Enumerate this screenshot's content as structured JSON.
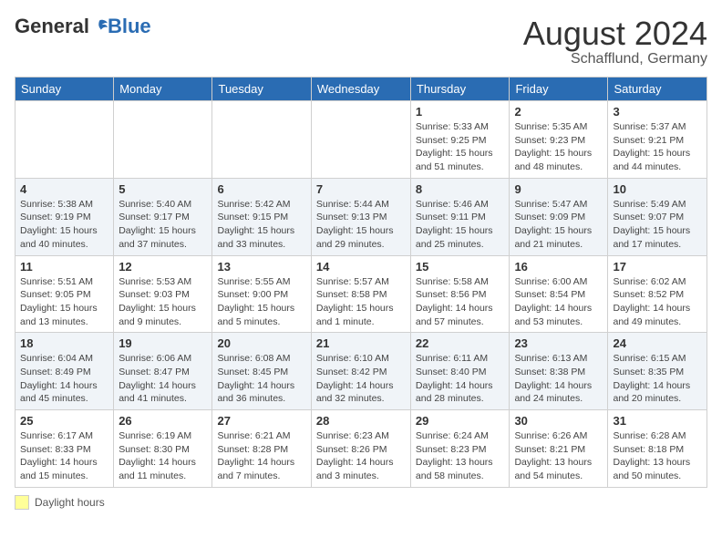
{
  "header": {
    "logo_general": "General",
    "logo_blue": "Blue",
    "month_year": "August 2024",
    "location": "Schafflund, Germany"
  },
  "days_of_week": [
    "Sunday",
    "Monday",
    "Tuesday",
    "Wednesday",
    "Thursday",
    "Friday",
    "Saturday"
  ],
  "legend": {
    "label": "Daylight hours"
  },
  "weeks": [
    [
      {
        "day": "",
        "info": ""
      },
      {
        "day": "",
        "info": ""
      },
      {
        "day": "",
        "info": ""
      },
      {
        "day": "",
        "info": ""
      },
      {
        "day": "1",
        "info": "Sunrise: 5:33 AM\nSunset: 9:25 PM\nDaylight: 15 hours\nand 51 minutes."
      },
      {
        "day": "2",
        "info": "Sunrise: 5:35 AM\nSunset: 9:23 PM\nDaylight: 15 hours\nand 48 minutes."
      },
      {
        "day": "3",
        "info": "Sunrise: 5:37 AM\nSunset: 9:21 PM\nDaylight: 15 hours\nand 44 minutes."
      }
    ],
    [
      {
        "day": "4",
        "info": "Sunrise: 5:38 AM\nSunset: 9:19 PM\nDaylight: 15 hours\nand 40 minutes."
      },
      {
        "day": "5",
        "info": "Sunrise: 5:40 AM\nSunset: 9:17 PM\nDaylight: 15 hours\nand 37 minutes."
      },
      {
        "day": "6",
        "info": "Sunrise: 5:42 AM\nSunset: 9:15 PM\nDaylight: 15 hours\nand 33 minutes."
      },
      {
        "day": "7",
        "info": "Sunrise: 5:44 AM\nSunset: 9:13 PM\nDaylight: 15 hours\nand 29 minutes."
      },
      {
        "day": "8",
        "info": "Sunrise: 5:46 AM\nSunset: 9:11 PM\nDaylight: 15 hours\nand 25 minutes."
      },
      {
        "day": "9",
        "info": "Sunrise: 5:47 AM\nSunset: 9:09 PM\nDaylight: 15 hours\nand 21 minutes."
      },
      {
        "day": "10",
        "info": "Sunrise: 5:49 AM\nSunset: 9:07 PM\nDaylight: 15 hours\nand 17 minutes."
      }
    ],
    [
      {
        "day": "11",
        "info": "Sunrise: 5:51 AM\nSunset: 9:05 PM\nDaylight: 15 hours\nand 13 minutes."
      },
      {
        "day": "12",
        "info": "Sunrise: 5:53 AM\nSunset: 9:03 PM\nDaylight: 15 hours\nand 9 minutes."
      },
      {
        "day": "13",
        "info": "Sunrise: 5:55 AM\nSunset: 9:00 PM\nDaylight: 15 hours\nand 5 minutes."
      },
      {
        "day": "14",
        "info": "Sunrise: 5:57 AM\nSunset: 8:58 PM\nDaylight: 15 hours\nand 1 minute."
      },
      {
        "day": "15",
        "info": "Sunrise: 5:58 AM\nSunset: 8:56 PM\nDaylight: 14 hours\nand 57 minutes."
      },
      {
        "day": "16",
        "info": "Sunrise: 6:00 AM\nSunset: 8:54 PM\nDaylight: 14 hours\nand 53 minutes."
      },
      {
        "day": "17",
        "info": "Sunrise: 6:02 AM\nSunset: 8:52 PM\nDaylight: 14 hours\nand 49 minutes."
      }
    ],
    [
      {
        "day": "18",
        "info": "Sunrise: 6:04 AM\nSunset: 8:49 PM\nDaylight: 14 hours\nand 45 minutes."
      },
      {
        "day": "19",
        "info": "Sunrise: 6:06 AM\nSunset: 8:47 PM\nDaylight: 14 hours\nand 41 minutes."
      },
      {
        "day": "20",
        "info": "Sunrise: 6:08 AM\nSunset: 8:45 PM\nDaylight: 14 hours\nand 36 minutes."
      },
      {
        "day": "21",
        "info": "Sunrise: 6:10 AM\nSunset: 8:42 PM\nDaylight: 14 hours\nand 32 minutes."
      },
      {
        "day": "22",
        "info": "Sunrise: 6:11 AM\nSunset: 8:40 PM\nDaylight: 14 hours\nand 28 minutes."
      },
      {
        "day": "23",
        "info": "Sunrise: 6:13 AM\nSunset: 8:38 PM\nDaylight: 14 hours\nand 24 minutes."
      },
      {
        "day": "24",
        "info": "Sunrise: 6:15 AM\nSunset: 8:35 PM\nDaylight: 14 hours\nand 20 minutes."
      }
    ],
    [
      {
        "day": "25",
        "info": "Sunrise: 6:17 AM\nSunset: 8:33 PM\nDaylight: 14 hours\nand 15 minutes."
      },
      {
        "day": "26",
        "info": "Sunrise: 6:19 AM\nSunset: 8:30 PM\nDaylight: 14 hours\nand 11 minutes."
      },
      {
        "day": "27",
        "info": "Sunrise: 6:21 AM\nSunset: 8:28 PM\nDaylight: 14 hours\nand 7 minutes."
      },
      {
        "day": "28",
        "info": "Sunrise: 6:23 AM\nSunset: 8:26 PM\nDaylight: 14 hours\nand 3 minutes."
      },
      {
        "day": "29",
        "info": "Sunrise: 6:24 AM\nSunset: 8:23 PM\nDaylight: 13 hours\nand 58 minutes."
      },
      {
        "day": "30",
        "info": "Sunrise: 6:26 AM\nSunset: 8:21 PM\nDaylight: 13 hours\nand 54 minutes."
      },
      {
        "day": "31",
        "info": "Sunrise: 6:28 AM\nSunset: 8:18 PM\nDaylight: 13 hours\nand 50 minutes."
      }
    ]
  ]
}
